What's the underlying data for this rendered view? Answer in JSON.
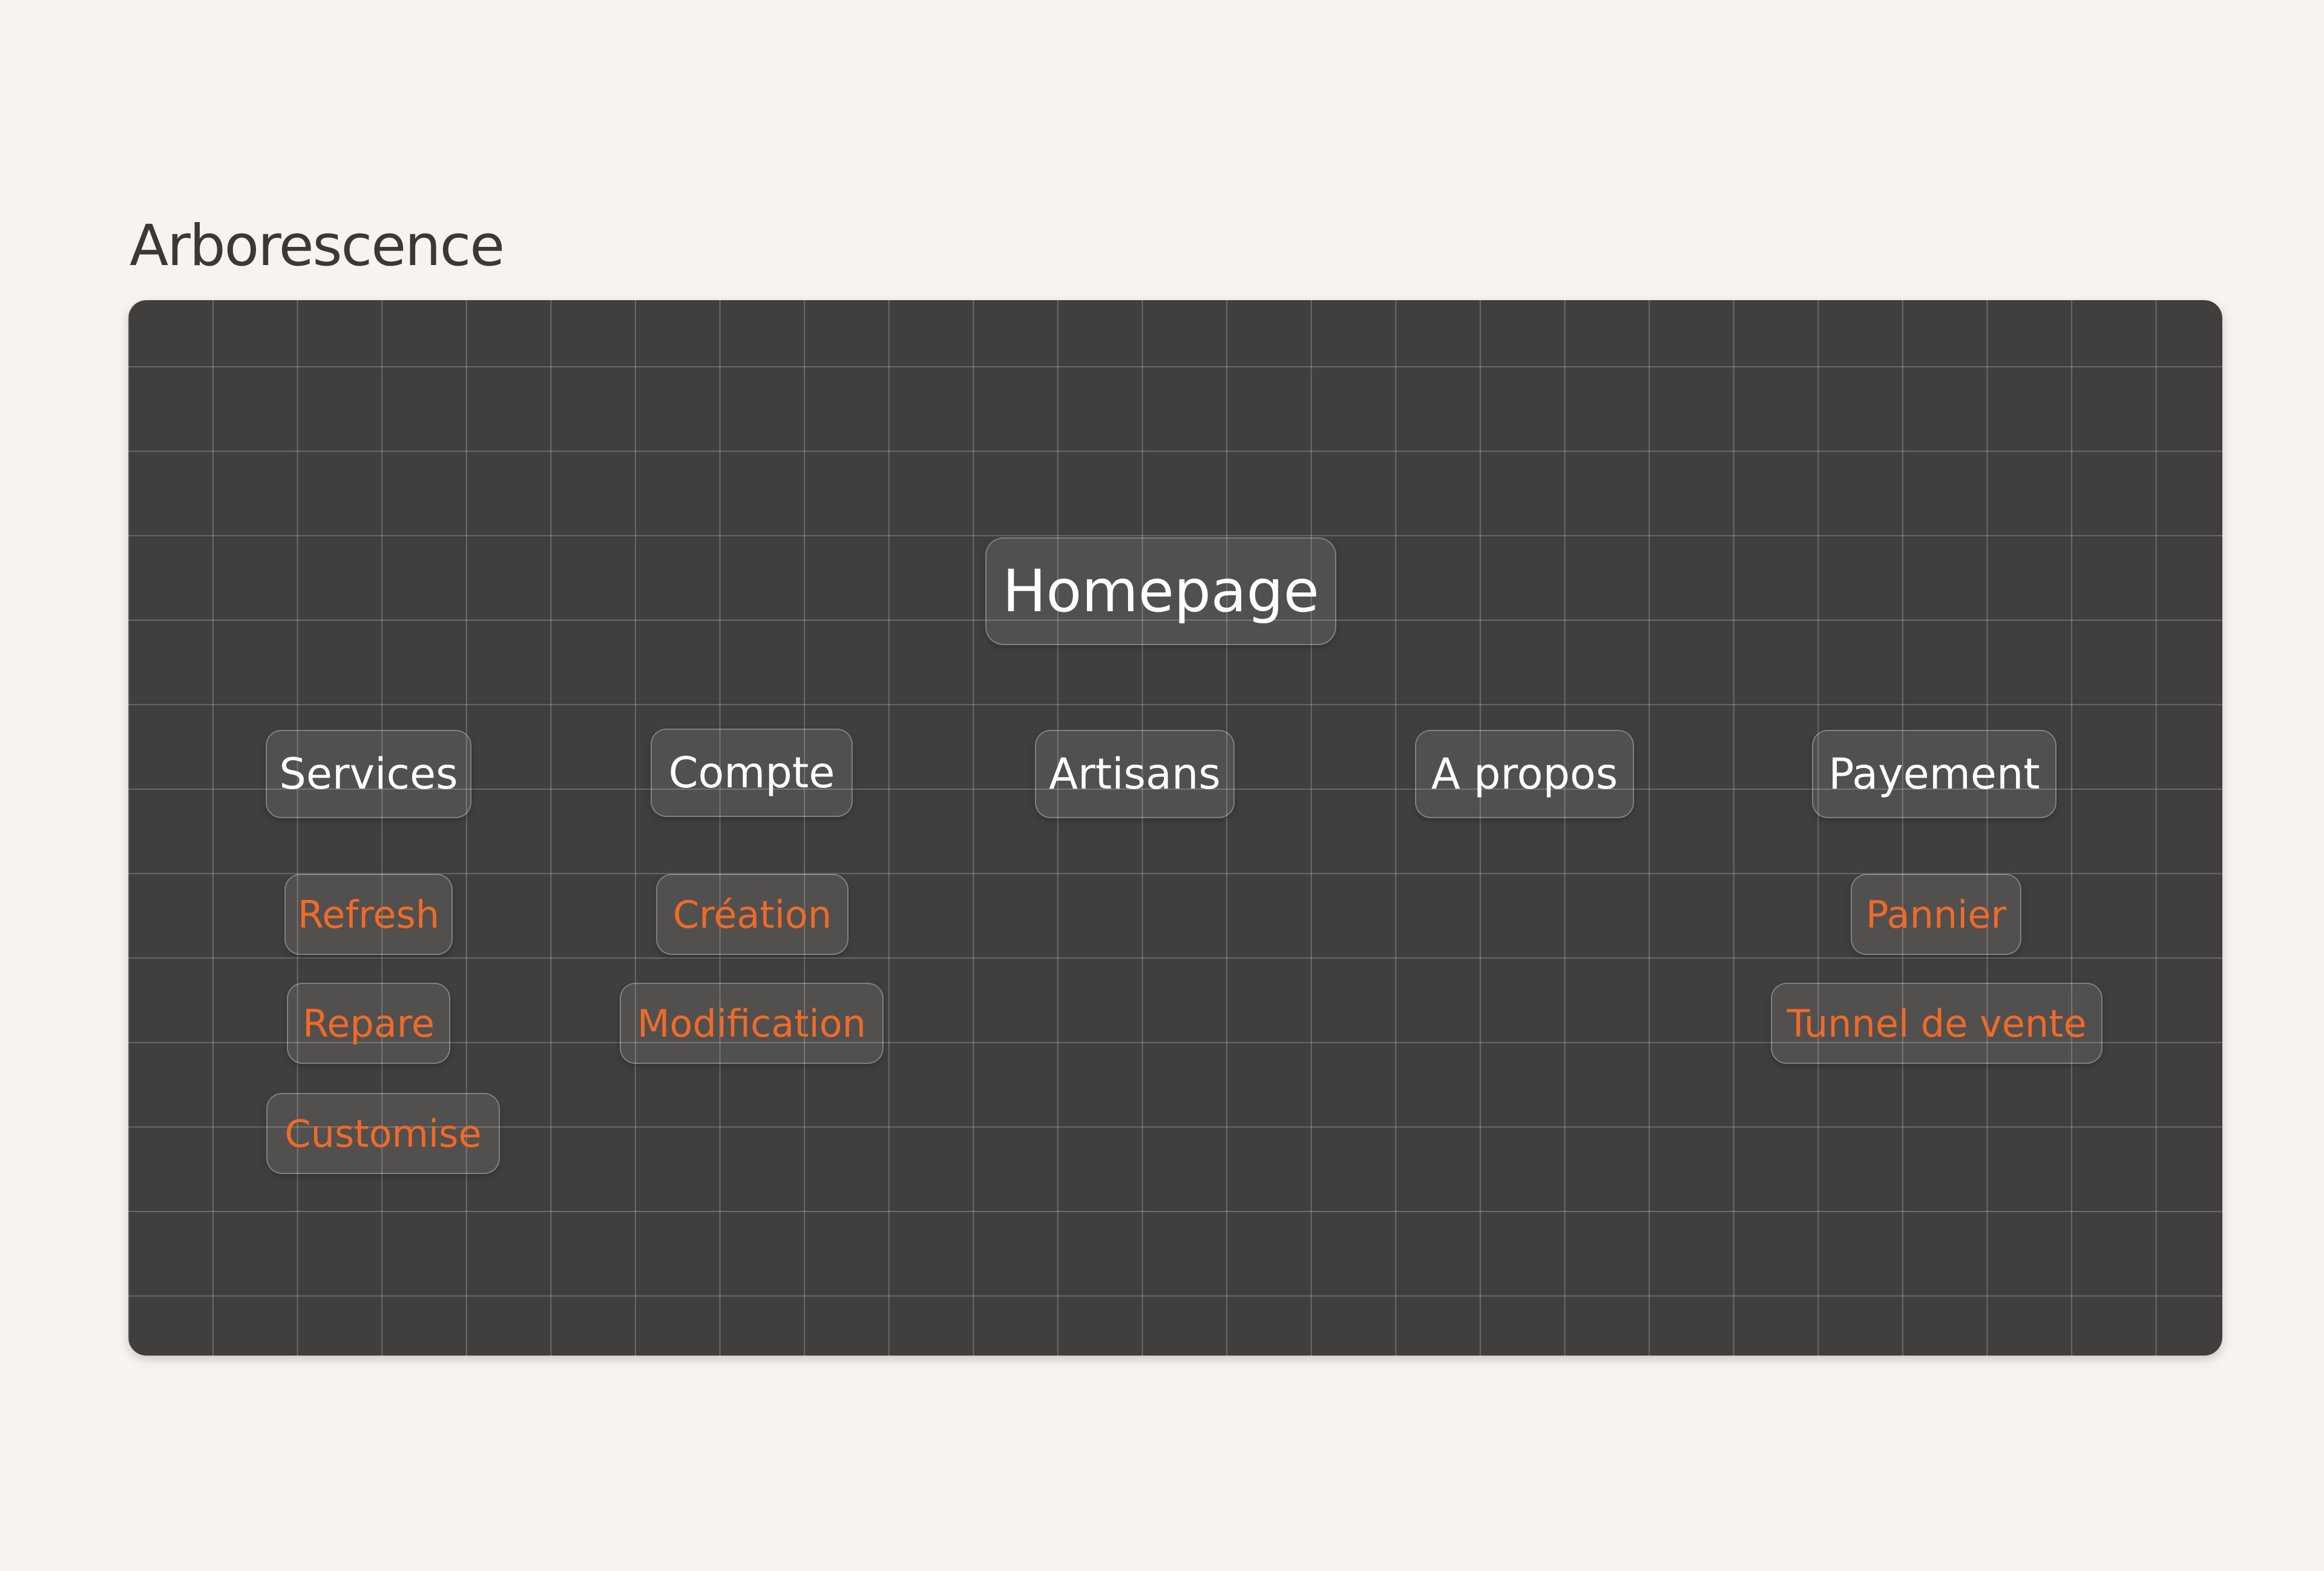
{
  "title": "Arborescence",
  "tree": {
    "root": "Homepage",
    "sections": [
      {
        "label": "Services",
        "children": [
          "Refresh",
          "Repare",
          "Customise"
        ]
      },
      {
        "label": "Compte",
        "children": [
          "Création",
          "Modification"
        ]
      },
      {
        "label": "Artisans",
        "children": []
      },
      {
        "label": "A propos",
        "children": []
      },
      {
        "label": "Payement",
        "children": [
          "Pannier",
          "Tunnel de vente"
        ]
      }
    ]
  },
  "colors": {
    "background": "#f8f3ef",
    "board": "#403f3d",
    "section_text": "#ffffff",
    "sub_text": "#f06a28"
  }
}
